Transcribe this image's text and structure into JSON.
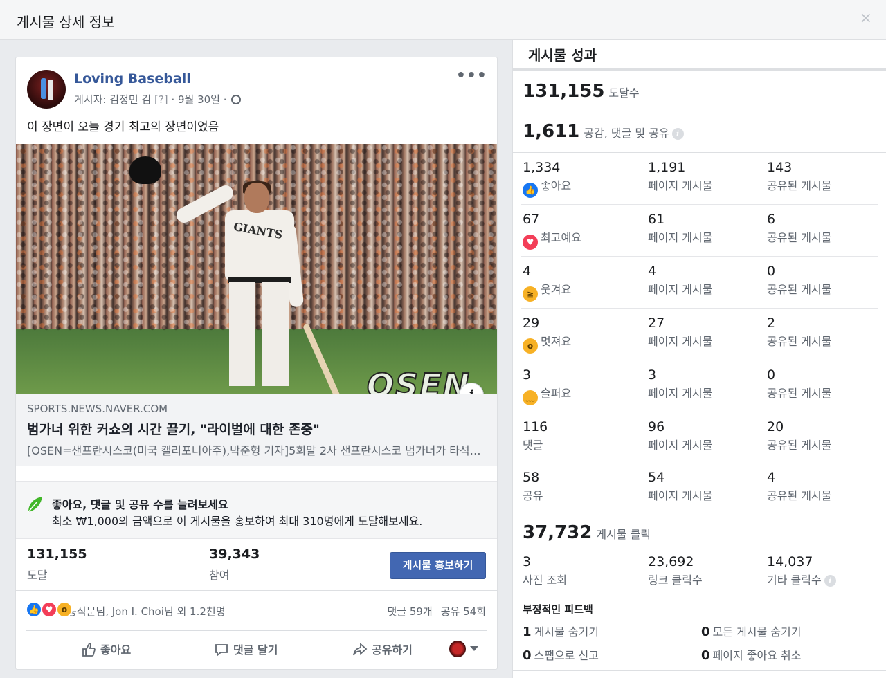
{
  "dialog": {
    "title": "게시물 상세 정보",
    "close_glyph": "×"
  },
  "post": {
    "page_name": "Loving Baseball",
    "byline_prefix": "게시자: 김정민 김",
    "byline_q": "[?]",
    "byline_date": "· 9월 30일 ·",
    "more_glyph": "•••",
    "message": "이 장면이 오늘 경기 최고의 장면이었음",
    "photo_watermark": "OSEN",
    "info_glyph": "i",
    "link": {
      "domain": "SPORTS.NEWS.NAVER.COM",
      "title": "범가너 위한 커쇼의 시간 끌기, \"라이벌에 대한 존중\"",
      "description": "[OSEN=샌프란시스코(미국 캘리포니아주),박준형 기자]5회말 2사 샌프란시스코 범가너가 타석에 들어서자 다저스 커쇼가"
    },
    "promo": {
      "title": "좋아요, 댓글 및 공유 수를 늘려보세요",
      "description": "최소 ₩1,000의 금액으로 이 게시물을 홍보하여 최대 310명에게 도달해보세요."
    },
    "stats": {
      "reach_value": "131,155",
      "reach_label": "도달",
      "engagement_value": "39,343",
      "engagement_label": "참여",
      "boost_label": "게시물 홍보하기"
    },
    "reactions": {
      "names": "동식문님, Jon I. Choi님 외 1.2천명",
      "comments": "댓글 59개",
      "shares": "공유 54회"
    },
    "actions": {
      "like": "좋아요",
      "comment": "댓글 달기",
      "share": "공유하기"
    }
  },
  "panel": {
    "title": "게시물 성과",
    "reach": {
      "value": "131,155",
      "label": "도달수"
    },
    "engagement": {
      "value": "1,611",
      "label": "공감, 댓글 및 공유"
    },
    "rows": [
      {
        "total": "1,334",
        "label": "좋아요",
        "icon": "like-icon",
        "page": "1,191",
        "page_label": "페이지 게시물",
        "shared": "143",
        "shared_label": "공유된 게시물"
      },
      {
        "total": "67",
        "label": "최고예요",
        "icon": "love-icon",
        "page": "61",
        "page_label": "페이지 게시물",
        "shared": "6",
        "shared_label": "공유된 게시물"
      },
      {
        "total": "4",
        "label": "웃겨요",
        "icon": "haha-icon",
        "page": "4",
        "page_label": "페이지 게시물",
        "shared": "0",
        "shared_label": "공유된 게시물"
      },
      {
        "total": "29",
        "label": "멋져요",
        "icon": "wow-icon",
        "page": "27",
        "page_label": "페이지 게시물",
        "shared": "2",
        "shared_label": "공유된 게시물"
      },
      {
        "total": "3",
        "label": "슬퍼요",
        "icon": "sad-icon",
        "page": "3",
        "page_label": "페이지 게시물",
        "shared": "0",
        "shared_label": "공유된 게시물"
      },
      {
        "total": "116",
        "label": "댓글",
        "icon": "",
        "page": "96",
        "page_label": "페이지 게시물",
        "shared": "20",
        "shared_label": "공유된 게시물"
      },
      {
        "total": "58",
        "label": "공유",
        "icon": "",
        "page": "54",
        "page_label": "페이지 게시물",
        "shared": "4",
        "shared_label": "공유된 게시물"
      }
    ],
    "clicks": {
      "value": "37,732",
      "label": "게시물 클릭",
      "photo_views": "3",
      "photo_views_label": "사진 조회",
      "link_clicks": "23,692",
      "link_clicks_label": "링크 클릭수",
      "other_clicks": "14,037",
      "other_clicks_label": "기타 클릭수"
    },
    "negative": {
      "title": "부정적인 피드백",
      "hide_post_count": "1",
      "hide_post_label": "게시물 숨기기",
      "hide_all_count": "0",
      "hide_all_label": "모든 게시물 숨기기",
      "spam_count": "0",
      "spam_label": "스팸으로 신고",
      "unlike_count": "0",
      "unlike_label": "페이지 좋아요 취소"
    }
  },
  "colors": {
    "like": "#1877f2",
    "love": "#f33e58",
    "emoji_yellow": "#f7b125",
    "link": "#365899",
    "button": "#4267b2"
  }
}
